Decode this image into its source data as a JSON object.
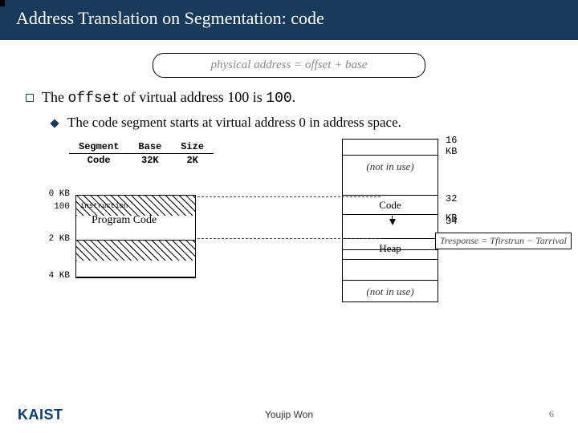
{
  "header": {
    "title": "Address Translation on Segmentation: code"
  },
  "formula": {
    "main": "physical address = offset + base",
    "overlay": "Tresponse = Tfirstrun − Tarrival"
  },
  "bullets": {
    "main_pre": "The ",
    "main_code": "offset",
    "main_mid": " of virtual address 100 is ",
    "main_val": "100",
    "main_end": ".",
    "sub": "The code segment starts at virtual address 0 in address space."
  },
  "seg_table": {
    "h1": "Segment",
    "h2": "Base",
    "h3": "Size",
    "r1": "Code",
    "r2": "32K",
    "r3": "2K"
  },
  "left": {
    "kb0": "0 KB",
    "a100": "100",
    "kb2": "2 KB",
    "kb4": "4 KB",
    "instr": "instruction",
    "program": "Program Code"
  },
  "right": {
    "kb16": "16 KB",
    "kb32": "32 KB",
    "kb34": "34 KB",
    "notuse": "(not in use)",
    "code": "Code",
    "heap": "Heap"
  },
  "footer": {
    "author": "Youjip Won",
    "page": "6",
    "logo": "KAIST"
  }
}
